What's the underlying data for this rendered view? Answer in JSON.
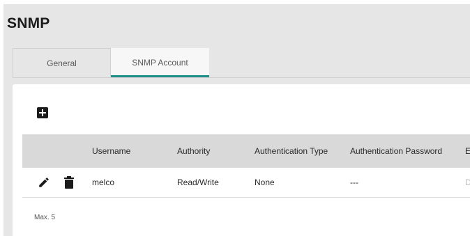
{
  "page": {
    "title": "SNMP"
  },
  "tabs": [
    {
      "label": "General"
    },
    {
      "label": "SNMP Account"
    }
  ],
  "table": {
    "columns": [
      "Username",
      "Authority",
      "Authentication Type",
      "Authentication Password",
      "E"
    ],
    "rows": [
      {
        "username": "melco",
        "authority": "Read/Write",
        "auth_type": "None",
        "auth_password": "---",
        "extra": "D"
      }
    ]
  },
  "footer": {
    "max_note": "Max. 5"
  },
  "colors": {
    "accent": "#1f8f8a",
    "header_bg": "#d9d9d9",
    "page_bg": "#e6e6e6"
  },
  "icons": [
    "add-icon",
    "edit-icon",
    "delete-icon"
  ]
}
